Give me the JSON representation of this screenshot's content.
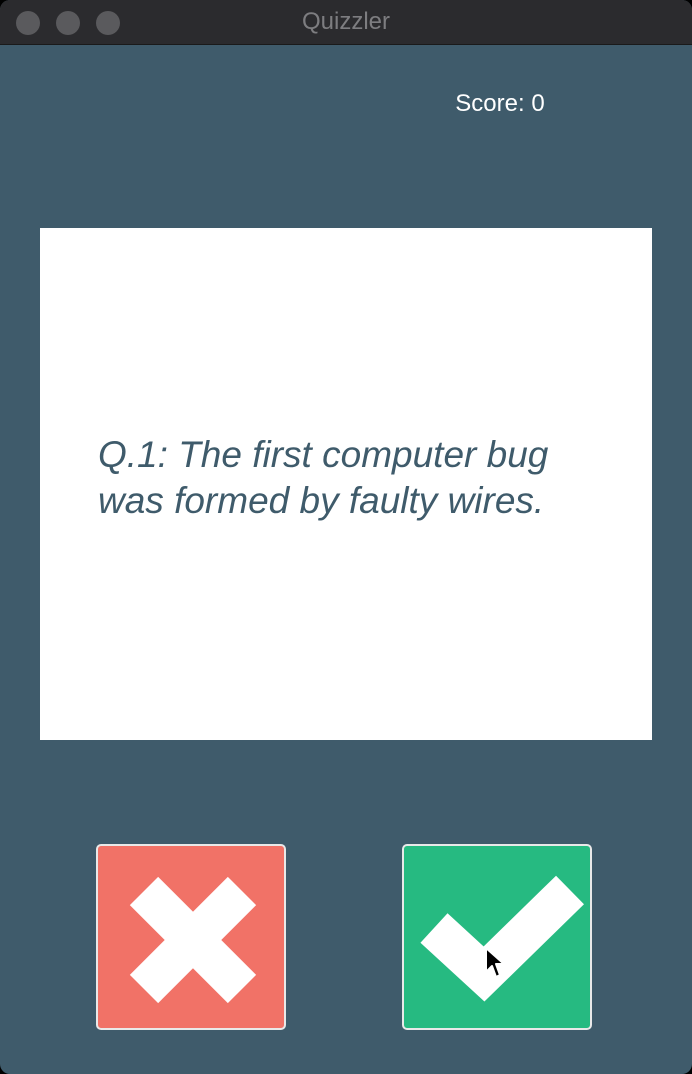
{
  "window": {
    "title": "Quizzler"
  },
  "score": {
    "label": "Score: 0"
  },
  "question": {
    "text": "Q.1: The first computer bug was formed by faulty wires."
  },
  "buttons": {
    "false_icon": "cross-icon",
    "true_icon": "check-icon"
  },
  "colors": {
    "background": "#3f5b6b",
    "card": "#ffffff",
    "false_button": "#f17267",
    "true_button": "#26ba81",
    "icon": "#ffffff"
  }
}
